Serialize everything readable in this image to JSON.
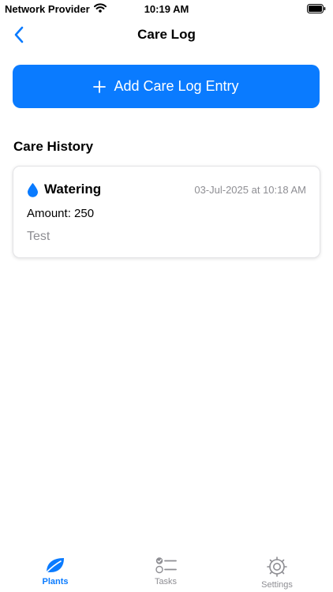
{
  "status": {
    "carrier": "Network Provider",
    "time": "10:19 AM"
  },
  "nav": {
    "title": "Care Log"
  },
  "actions": {
    "add_entry_label": "Add Care Log Entry"
  },
  "section": {
    "title": "Care History"
  },
  "entries": [
    {
      "type": "Watering",
      "icon": "water-drop-icon",
      "timestamp": "03-Jul-2025 at 10:18 AM",
      "amount": "Amount: 250",
      "note": "Test"
    }
  ],
  "tabs": [
    {
      "label": "Plants",
      "icon": "leaf-icon",
      "active": true
    },
    {
      "label": "Tasks",
      "icon": "checklist-icon",
      "active": false
    },
    {
      "label": "Settings",
      "icon": "gear-icon",
      "active": false
    }
  ],
  "colors": {
    "accent": "#0a7bff",
    "secondary_text": "#8e8e93"
  }
}
